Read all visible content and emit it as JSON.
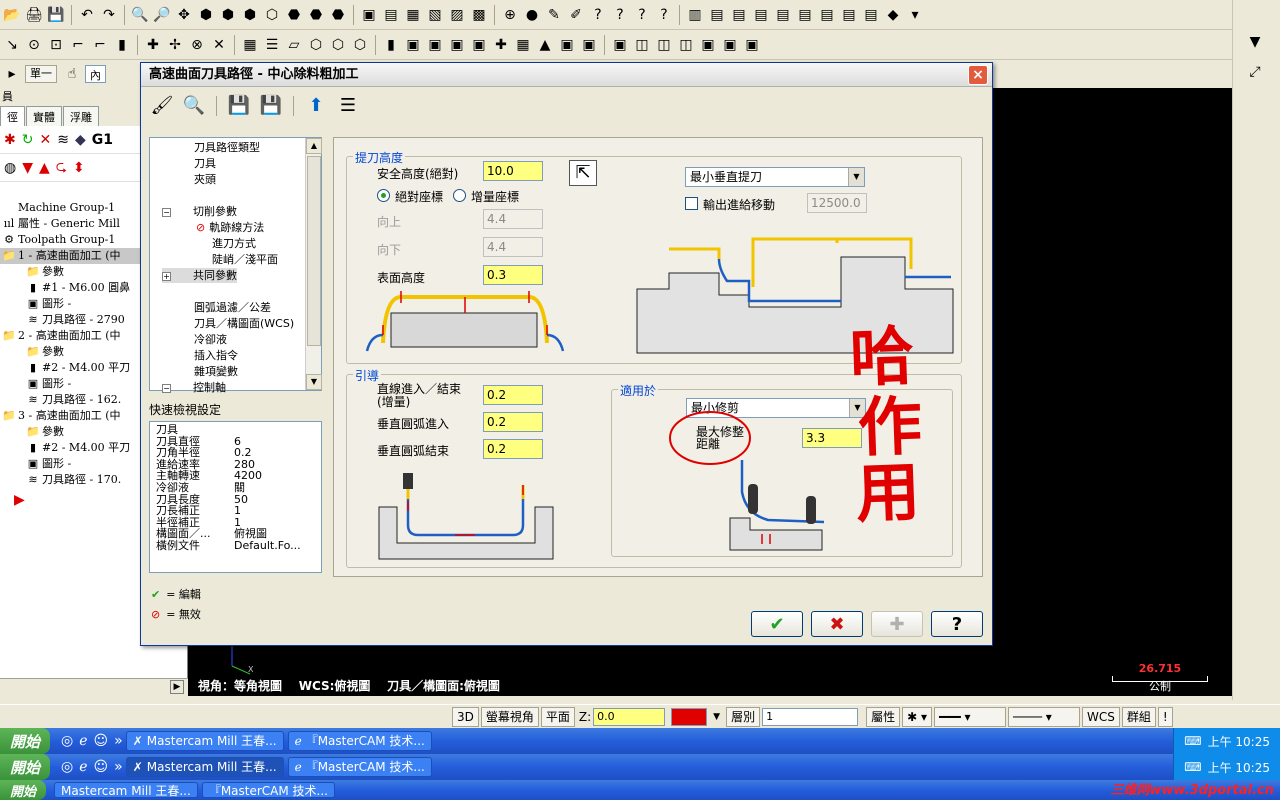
{
  "dialog": {
    "title": "高速曲面刀具路徑 - 中心除料粗加工",
    "close_label": "×",
    "nav_items": [
      {
        "label": "刀具路徑類型",
        "indent": 1
      },
      {
        "label": "刀具",
        "indent": 1
      },
      {
        "label": "夾頭",
        "indent": 1
      },
      {
        "label": "",
        "indent": 1
      },
      {
        "label": "切削參數",
        "indent": 0,
        "expander": "−"
      },
      {
        "label": "軌跡線方法",
        "indent": 1,
        "invalid": true
      },
      {
        "label": "進刀方式",
        "indent": 2
      },
      {
        "label": "陡峭／淺平面",
        "indent": 2
      },
      {
        "label": "共同參數",
        "indent": 0,
        "expander": "+",
        "selected": true
      },
      {
        "label": "",
        "indent": 1
      },
      {
        "label": "圓弧過濾／公差",
        "indent": 1
      },
      {
        "label": "刀具／構圖面(WCS)",
        "indent": 1
      },
      {
        "label": "冷卻液",
        "indent": 1
      },
      {
        "label": "插入指令",
        "indent": 1
      },
      {
        "label": "雜項變數",
        "indent": 1
      },
      {
        "label": "控制軸",
        "indent": 0,
        "expander": "−"
      }
    ],
    "quickview": {
      "label": "快速檢視設定",
      "rows": [
        {
          "k": "刀具",
          "v": ""
        },
        {
          "k": "刀具直徑",
          "v": "6"
        },
        {
          "k": "刀角半徑",
          "v": "0.2"
        },
        {
          "k": "進給速率",
          "v": "280"
        },
        {
          "k": "主軸轉速",
          "v": "4200"
        },
        {
          "k": "冷卻液",
          "v": "關"
        },
        {
          "k": "刀具長度",
          "v": "50"
        },
        {
          "k": "刀長補正",
          "v": "1"
        },
        {
          "k": "半徑補正",
          "v": "1"
        },
        {
          "k": "構圖面／...",
          "v": "俯視圖"
        },
        {
          "k": "橫例文件",
          "v": "Default.Fo..."
        }
      ]
    },
    "legend": {
      "edit": "= 編輯",
      "invalid": "= 無效"
    },
    "retract": {
      "group_label": "提刀高度",
      "safe_height_label": "安全高度(絕對)",
      "safe_height_value": "10.0",
      "abs_label": "絕對座標",
      "inc_label": "增量座標",
      "up_label": "向上",
      "up_value": "4.4",
      "down_label": "向下",
      "down_value": "4.4",
      "surface_label": "表面高度",
      "surface_value": "0.3",
      "retract_mode": "最小垂直提刀",
      "output_feed_label": "輸出進給移動",
      "output_feed_value": "12500.0"
    },
    "lead": {
      "group_label": "引導",
      "linear_label": "直線進入／結束\n(增量)",
      "linear_value": "0.2",
      "arc_in_label": "垂直圓弧進入",
      "arc_in_value": "0.2",
      "arc_out_label": "垂直圓弧結束",
      "arc_out_value": "0.2"
    },
    "apply": {
      "group_label": "適用於",
      "mode": "最小修剪",
      "max_trim_label": "最大修整\n距離",
      "max_trim_value": "3.3"
    },
    "buttons": {
      "ok": "✔",
      "cancel": "✖",
      "add": "✚",
      "help": "?"
    }
  },
  "annotation": {
    "text_line1": "哈",
    "text_line2": "作",
    "text_line3": "用",
    "color": "#e00000"
  },
  "toolbar": {
    "row1": [
      "📂",
      "🖨",
      "💾",
      "↶",
      "↷",
      "🔍",
      "🔎",
      "✥",
      "⬢",
      "⬢",
      "⬢",
      "⬡",
      "⬣",
      "⬣",
      "⬣",
      "▣",
      "▤",
      "▦",
      "▧",
      "▨",
      "▩",
      "⊕",
      "●",
      "✎",
      "✐",
      "?",
      "?",
      "?",
      "?",
      "▥",
      "▤",
      "▤",
      "▤",
      "▤",
      "▤",
      "▤",
      "▤",
      "▤",
      "◆",
      "▾"
    ],
    "row2": [
      "↘",
      "⊙",
      "⊡",
      "⌐",
      "⌐",
      "▮",
      "✚",
      "✢",
      "⊗",
      "✕",
      "▦",
      "☰",
      "▱",
      "⬡",
      "⬡",
      "⬡",
      "▮",
      "▣",
      "▣",
      "▣",
      "▣",
      "✚",
      "▦",
      "▲",
      "▣",
      "▣",
      "▣",
      "◫",
      "◫",
      "◫",
      "▣",
      "▣",
      "▣"
    ],
    "row3_btn": "單一",
    "row3_field": "內"
  },
  "leftpanel": {
    "title": "員",
    "tabs": [
      "徑",
      "實體",
      "浮雕"
    ],
    "tree": [
      {
        "label": "Machine Group-1",
        "icon": "",
        "depth": 0
      },
      {
        "label": "屬性 - Generic Mill",
        "icon": "ııl",
        "depth": 0
      },
      {
        "label": "Toolpath Group-1",
        "icon": "⚙",
        "depth": 0
      },
      {
        "label": "1 - 高速曲面加工 (中",
        "icon": "📁",
        "depth": 0,
        "selected": true
      },
      {
        "label": "參數",
        "icon": "📁",
        "depth": 1
      },
      {
        "label": "#1 - M6.00 圓鼻",
        "icon": "▮",
        "depth": 1
      },
      {
        "label": "圖形 -",
        "icon": "▣",
        "depth": 1
      },
      {
        "label": "刀具路徑 - 2790",
        "icon": "≋",
        "depth": 1
      },
      {
        "label": "2 - 高速曲面加工 (中",
        "icon": "📁",
        "depth": 0
      },
      {
        "label": "參數",
        "icon": "📁",
        "depth": 1
      },
      {
        "label": "#2 - M4.00 平刀",
        "icon": "▮",
        "depth": 1
      },
      {
        "label": "圖形 -",
        "icon": "▣",
        "depth": 1
      },
      {
        "label": "刀具路徑 - 162.",
        "icon": "≋",
        "depth": 1
      },
      {
        "label": "3 - 高速曲面加工 (中",
        "icon": "📁",
        "depth": 0
      },
      {
        "label": "參數",
        "icon": "📁",
        "depth": 1
      },
      {
        "label": "#2 - M4.00 平刀",
        "icon": "▮",
        "depth": 1
      },
      {
        "label": "圖形 -",
        "icon": "▣",
        "depth": 1
      },
      {
        "label": "刀具路徑 - 170.",
        "icon": "≋",
        "depth": 1
      }
    ]
  },
  "graphics": {
    "status": "視角：等角視圖    WCS:俯視圖    刀具／構圖面:俯視圖",
    "scale_value": "26.715",
    "scale_unit": "公制"
  },
  "statusbar": {
    "btn_3d": "3D",
    "btn_screen_view": "螢幕視角",
    "btn_plane": "平面",
    "z_label": "Z:",
    "z_value": "0.0",
    "color_value": "12",
    "level_label": "層別",
    "level_value": "1",
    "attr_label": "屬性",
    "wcs_label": "WCS",
    "group_label": "群組"
  },
  "taskbar": {
    "start": "開始",
    "task1": "Mastercam Mill 王春...",
    "task2": "『MasterCAM 技术...",
    "clock": "上午 10:25",
    "watermark": "三维网www.3dportal.cn"
  }
}
